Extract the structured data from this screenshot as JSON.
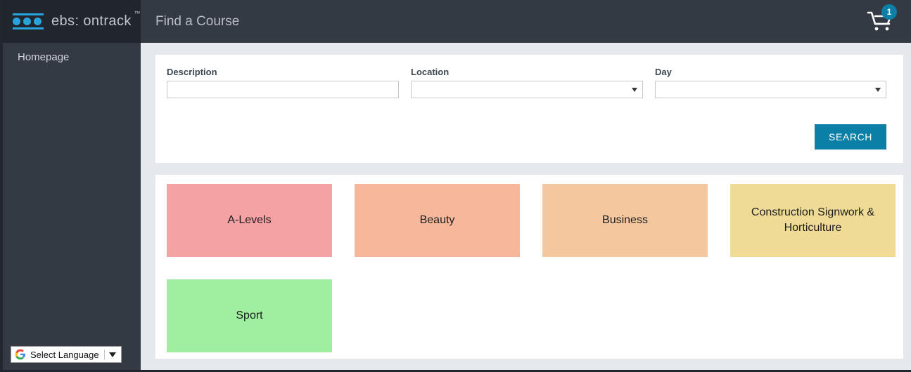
{
  "brand": {
    "logo_text": "ebs: ontrack",
    "trademark": "™",
    "logo_icon": "three-dots-logo",
    "accent_color": "#29a3dc"
  },
  "header": {
    "title": "Find a Course",
    "cart_icon": "shopping-cart-icon",
    "cart_badge_count": "1",
    "badge_color": "#0b7fa5"
  },
  "sidebar": {
    "items": [
      {
        "label": "Homepage"
      }
    ],
    "language_widget": {
      "icon": "google-g-icon",
      "label": "Select Language",
      "caret": "chevron-down-icon"
    }
  },
  "search": {
    "description": {
      "label": "Description",
      "value": "",
      "placeholder": ""
    },
    "location": {
      "label": "Location",
      "value": "",
      "options": []
    },
    "day": {
      "label": "Day",
      "value": "",
      "options": []
    },
    "submit_label": "SEARCH",
    "button_color": "#0b7fa5"
  },
  "categories": {
    "tiles": [
      {
        "label": "A-Levels",
        "color": "#f4a2a3"
      },
      {
        "label": "Beauty",
        "color": "#f7b79b"
      },
      {
        "label": "Business",
        "color": "#f5c79e"
      },
      {
        "label": "Construction Signwork & Horticulture",
        "color": "#efdb96"
      },
      {
        "label": "Sport",
        "color": "#a0eea0"
      }
    ]
  }
}
